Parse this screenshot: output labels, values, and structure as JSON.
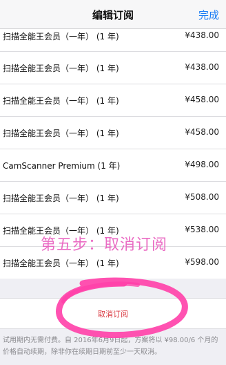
{
  "nav": {
    "title": "编辑订阅",
    "done_label": "完成"
  },
  "subscriptions": [
    {
      "name": "扫描全能王会员（一年） (1 年)",
      "price": "¥438.00"
    },
    {
      "name": "扫描全能王会员（一年） (1 年)",
      "price": "¥438.00"
    },
    {
      "name": "扫描全能王会员（一年） (1 年)",
      "price": "¥458.00"
    },
    {
      "name": "扫描全能王会员（一年） (1 年)",
      "price": "¥458.00"
    },
    {
      "name": "CamScanner Premium (1 年)",
      "price": "¥498.00"
    },
    {
      "name": "扫描全能王会员（一年） (1 年)",
      "price": "¥508.00"
    },
    {
      "name": "扫描全能王会员（一年） (1 年)",
      "price": "¥538.00"
    },
    {
      "name": "扫描全能王会员（一年） (1 年)",
      "price": "¥598.00"
    }
  ],
  "cancel": {
    "label": "取消订阅"
  },
  "footer": {
    "text": "试用期内无需付费。自 2016年6月9日起，方案将以 ¥98.00/6 个月的价格自动续期，除非你在续期日期前至少一天取消。"
  },
  "annotation": {
    "step_text": "第五步：取消订阅",
    "accent_color": "#ff3fa8"
  },
  "colors": {
    "nav_done": "#1a7cf5",
    "cancel_text": "#d9363e",
    "background": "#efeff4"
  }
}
